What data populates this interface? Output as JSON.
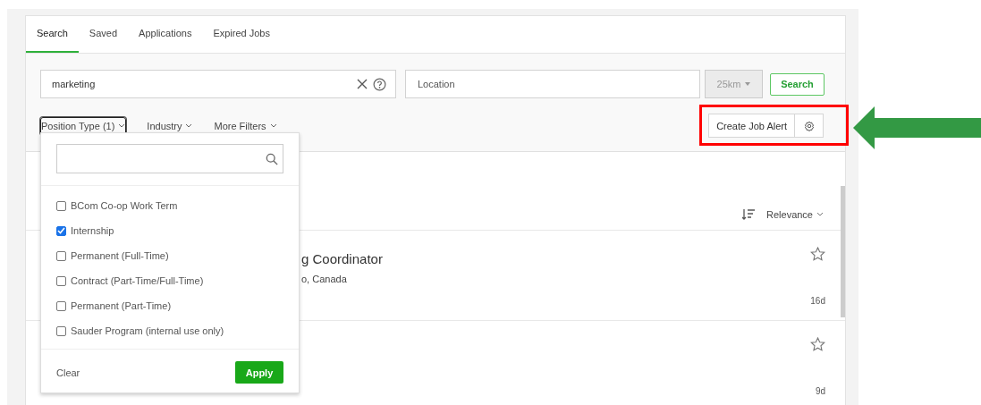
{
  "tabs": [
    {
      "label": "Search",
      "selected": true
    },
    {
      "label": "Saved",
      "selected": false
    },
    {
      "label": "Applications",
      "selected": false
    },
    {
      "label": "Expired Jobs",
      "selected": false
    }
  ],
  "search": {
    "keyword": "marketing",
    "location_placeholder": "Location",
    "radius": "25km",
    "radius_disabled": true,
    "button": "Search"
  },
  "filters": [
    {
      "label": "Position Type (1)",
      "focused": true
    },
    {
      "label": "Industry",
      "focused": false
    },
    {
      "label": "More Filters",
      "focused": false
    }
  ],
  "alert": {
    "button": "Create Job Alert"
  },
  "sort": {
    "label": "Relevance"
  },
  "jobs": [
    {
      "title": "g Coordinator",
      "location": "o, Canada",
      "age": "16d",
      "starred": false
    },
    {
      "age": "9d",
      "starred": false
    }
  ],
  "dropdown": {
    "options": [
      {
        "label": "BCom Co-op Work Term",
        "checked": false
      },
      {
        "label": "Internship",
        "checked": true
      },
      {
        "label": "Permanent (Full-Time)",
        "checked": false
      },
      {
        "label": "Contract (Part-Time/Full-Time)",
        "checked": false
      },
      {
        "label": "Permanent (Part-Time)",
        "checked": false
      },
      {
        "label": "Sauder Program (internal use only)",
        "checked": false
      }
    ],
    "clear": "Clear",
    "apply": "Apply"
  }
}
